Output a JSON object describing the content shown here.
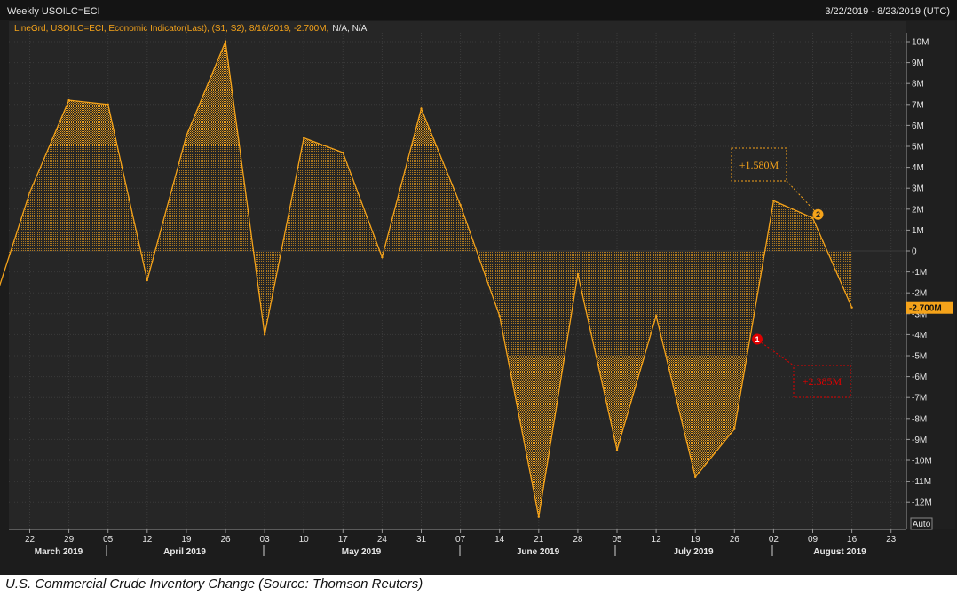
{
  "header": {
    "title": "Weekly USOILC=ECI",
    "date_range": "3/22/2019 - 8/23/2019 (UTC)",
    "legend_line": "LineGrd, USOILC=ECI, Economic Indicator(Last), (S1, S2), 8/16/2019, -2.700M,",
    "legend_na": "N/A, N/A"
  },
  "caption": "U.S. Commercial Crude Inventory Change (Source: Thomson Reuters)",
  "colors": {
    "background": "#1c1c1c",
    "plot_background": "#262626",
    "grid": "#3a3a3a",
    "series": "#f5a31a",
    "axis_text": "#e6e6e6",
    "annotation_2": "#f5a31a",
    "annotation_1": "#e00000"
  },
  "chart_data": {
    "type": "area",
    "title": "Weekly USOILC=ECI",
    "y_unit": "M",
    "ylim": [
      -13,
      10.5
    ],
    "y_ticks": [
      "10M",
      "9M",
      "8M",
      "7M",
      "6M",
      "5M",
      "4M",
      "3M",
      "2M",
      "1M",
      "0",
      "-1M",
      "-2M",
      "-3M",
      "-4M",
      "-5M",
      "-6M",
      "-7M",
      "-8M",
      "-9M",
      "-10M",
      "-11M",
      "-12M"
    ],
    "x_tick_labels": [
      "22",
      "29",
      "05",
      "12",
      "19",
      "26",
      "03",
      "10",
      "17",
      "24",
      "31",
      "07",
      "14",
      "21",
      "28",
      "05",
      "12",
      "19",
      "26",
      "02",
      "09",
      "16",
      "23"
    ],
    "month_labels": [
      "March 2019",
      "April 2019",
      "May 2019",
      "June 2019",
      "July 2019",
      "August 2019"
    ],
    "grid": true,
    "last_value_label": "-2.700M",
    "auto_label": "Auto",
    "series": [
      {
        "x": [
          "2019-03-15",
          "2019-03-22",
          "2019-03-29",
          "2019-04-05",
          "2019-04-12",
          "2019-04-19",
          "2019-04-26",
          "2019-05-03",
          "2019-05-10",
          "2019-05-17",
          "2019-05-24",
          "2019-05-31",
          "2019-06-07",
          "2019-06-14",
          "2019-06-21",
          "2019-06-28",
          "2019-07-05",
          "2019-07-12",
          "2019-07-19",
          "2019-07-26",
          "2019-08-02",
          "2019-08-09",
          "2019-08-16"
        ],
        "values": [
          -3.0,
          2.8,
          7.2,
          7.0,
          -1.4,
          5.5,
          10.0,
          -4.0,
          5.4,
          4.7,
          -0.3,
          6.8,
          2.2,
          -3.1,
          -12.7,
          -1.1,
          -9.5,
          -3.1,
          -10.8,
          -8.5,
          2.4,
          1.58,
          -2.7
        ]
      }
    ],
    "annotations": [
      {
        "id": "2",
        "text": "+1.580M",
        "x": "2019-08-09",
        "y": 1.58
      },
      {
        "id": "1",
        "text": "+2.385M",
        "x": "2019-07-31",
        "y": -4.3
      }
    ]
  }
}
